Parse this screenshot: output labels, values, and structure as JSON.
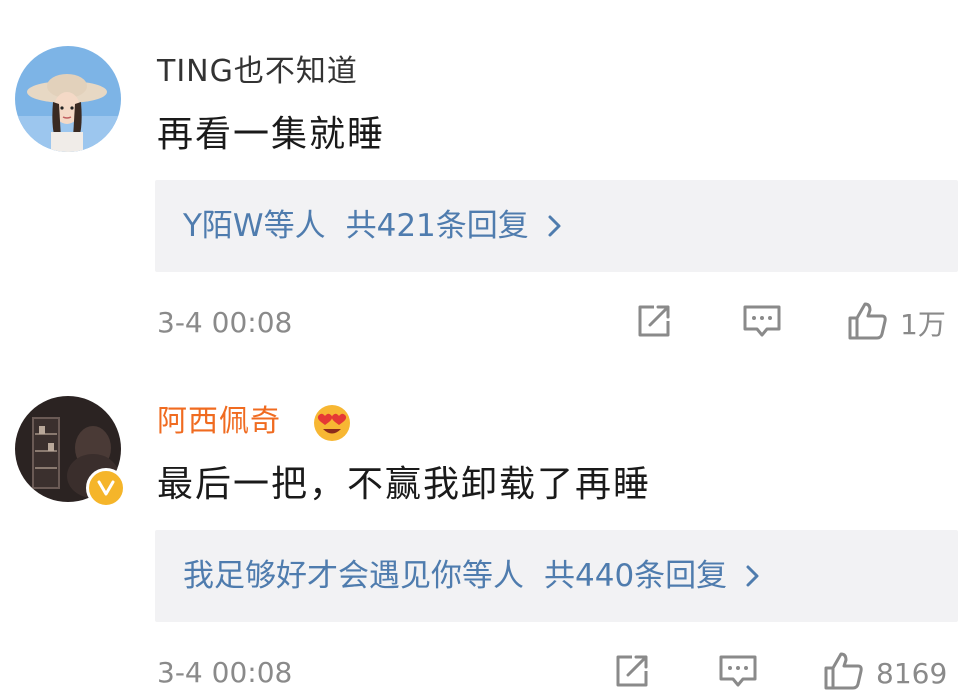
{
  "colors": {
    "username_vip": "#f06b20",
    "reply_link": "#4f7cae",
    "meta_gray": "#8a8a8a",
    "reply_box_bg": "#f2f2f4"
  },
  "comments": [
    {
      "username": "TING也不知道",
      "text": "再看一集就睡",
      "reply_users": "Y陌W等人",
      "reply_count": "共421条回复",
      "timestamp": "3-4 00:08",
      "like_count": "1万",
      "avatar_icon": "avatar-girl-hat",
      "icons": [
        "repost-icon",
        "comment-icon",
        "thumb-up-icon",
        "chevron-right-icon"
      ]
    },
    {
      "username": "阿西佩奇",
      "text": "最后一把，不赢我卸载了再睡",
      "reply_users": "我足够好才会遇见你等人",
      "reply_count": "共440条回复",
      "timestamp": "3-4 00:08",
      "like_count": "8169",
      "avatar_icon": "avatar-dark-room",
      "badge_icon": "verified-v-icon",
      "emoji_icon": "heart-eyes-emoji-icon",
      "icons": [
        "repost-icon",
        "comment-icon",
        "thumb-up-icon",
        "chevron-right-icon"
      ]
    }
  ]
}
